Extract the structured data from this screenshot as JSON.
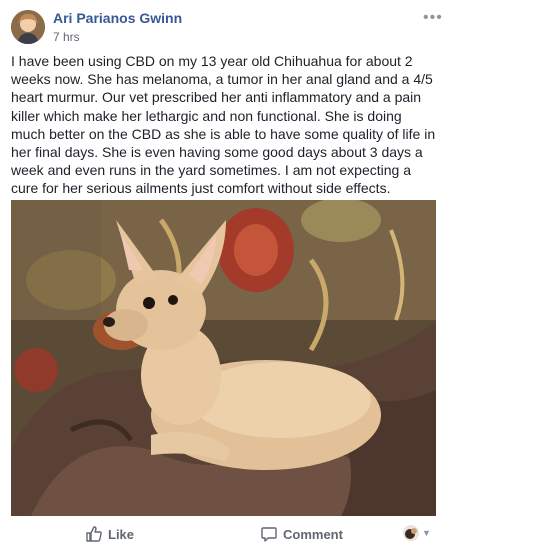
{
  "post": {
    "author": "Ari Parianos Gwinn",
    "timestamp": "7 hrs",
    "text": "I have been using CBD on my 13 year old Chihuahua for about 2 weeks now. She has melanoma, a tumor in her anal gland and a 4/5 heart murmur. Our vet prescribed her anti inflammatory and a pain killer which make her lethargic and non functional. She is doing much better on the CBD as she is able to have some quality of life in her final days. She is even having some good days about 3 days a week and even runs in the yard sometimes. I am not expecting a cure for her serious ailments just comfort without side effects."
  },
  "actions": {
    "like_label": "Like",
    "comment_label": "Comment"
  },
  "icons": {
    "options": "more-options-icon",
    "like": "thumbs-up-icon",
    "comment": "comment-bubble-icon",
    "reactor_caret": "chevron-down-icon"
  },
  "colors": {
    "author_link": "#385898",
    "secondary_text": "#616770",
    "action_text": "#606770"
  }
}
